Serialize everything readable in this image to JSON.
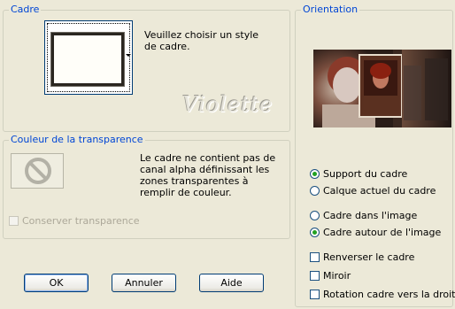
{
  "frame_group": {
    "legend": "Cadre",
    "hint": "Veuillez choisir un style de cadre.",
    "watermark": "Violette"
  },
  "transparency_group": {
    "legend": "Couleur de la transparence",
    "message": "Le cadre ne contient pas de canal alpha définissant les zones transparentes à remplir de couleur.",
    "keep_transparency_label": "Conserver transparence",
    "keep_transparency_checked": false,
    "keep_transparency_enabled": false,
    "swatch_icon": "no-symbol-icon"
  },
  "orientation_group": {
    "legend": "Orientation",
    "radios_target": [
      {
        "label": "Support du cadre",
        "checked": true
      },
      {
        "label": "Calque actuel du cadre",
        "checked": false
      }
    ],
    "radios_position": [
      {
        "label": "Cadre dans l'image",
        "checked": false
      },
      {
        "label": "Cadre autour de l'image",
        "checked": true
      }
    ],
    "checkboxes": [
      {
        "label": "Renverser le cadre",
        "checked": false
      },
      {
        "label": "Miroir",
        "checked": false
      },
      {
        "label": "Rotation cadre vers la droite",
        "checked": false
      }
    ]
  },
  "buttons": {
    "ok": "OK",
    "cancel": "Annuler",
    "help": "Aide"
  },
  "colors": {
    "window_bg": "#ece9d8",
    "group_title": "#0046d5",
    "radio_dot": "#21a121"
  }
}
